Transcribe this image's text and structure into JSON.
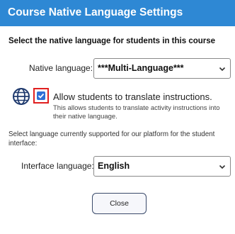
{
  "dialog": {
    "title": "Course Native Language Settings",
    "heading": "Select the native language for students in this course",
    "accent_color": "#2e88d4",
    "highlight_color": "#e02020"
  },
  "native_language": {
    "label": "Native language:",
    "selected": "***Multi-Language***"
  },
  "translate": {
    "icon": "globe-icon",
    "checked": true,
    "label": "Allow students to translate instructions.",
    "description": "This allows students to translate activity instructions into their native language."
  },
  "interface_language": {
    "help_text": "Select language currently supported for our platform for the student interface:",
    "label": "Interface language:",
    "selected": "English"
  },
  "actions": {
    "close_label": "Close"
  }
}
